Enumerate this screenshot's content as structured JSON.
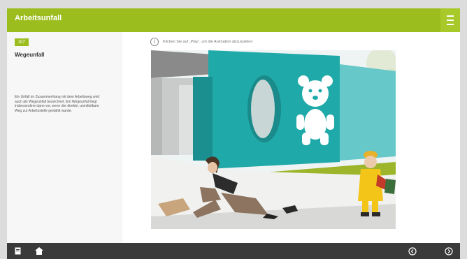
{
  "header": {
    "title": "Arbeitsunfall",
    "menu_icon": "hamburger-menu-icon",
    "accent_color": "#9bbd1e"
  },
  "sidebar": {
    "badge": "3/7",
    "section_title": "Wegeunfall",
    "description": "Ein Unfall im Zusammenhang mit dem Arbeitsweg wird auch als Wegeunfall bezeichnet. Ein Wegeunfall liegt insbesondere dann vor, wenn der direkte, unmittelbare Weg zur Arbeitsstelle gewählt wurde."
  },
  "main": {
    "hint_text": "Klicken Sie auf „Play“, um die Animation abzuspielen",
    "hint_icon": "info-icon",
    "illustration": "kindergarten-accident-scene"
  },
  "footer": {
    "buttons_left": [
      "document-icon",
      "home-icon"
    ],
    "buttons_right": [
      "previous-icon",
      "next-icon"
    ],
    "background": "#3a3a3a"
  }
}
